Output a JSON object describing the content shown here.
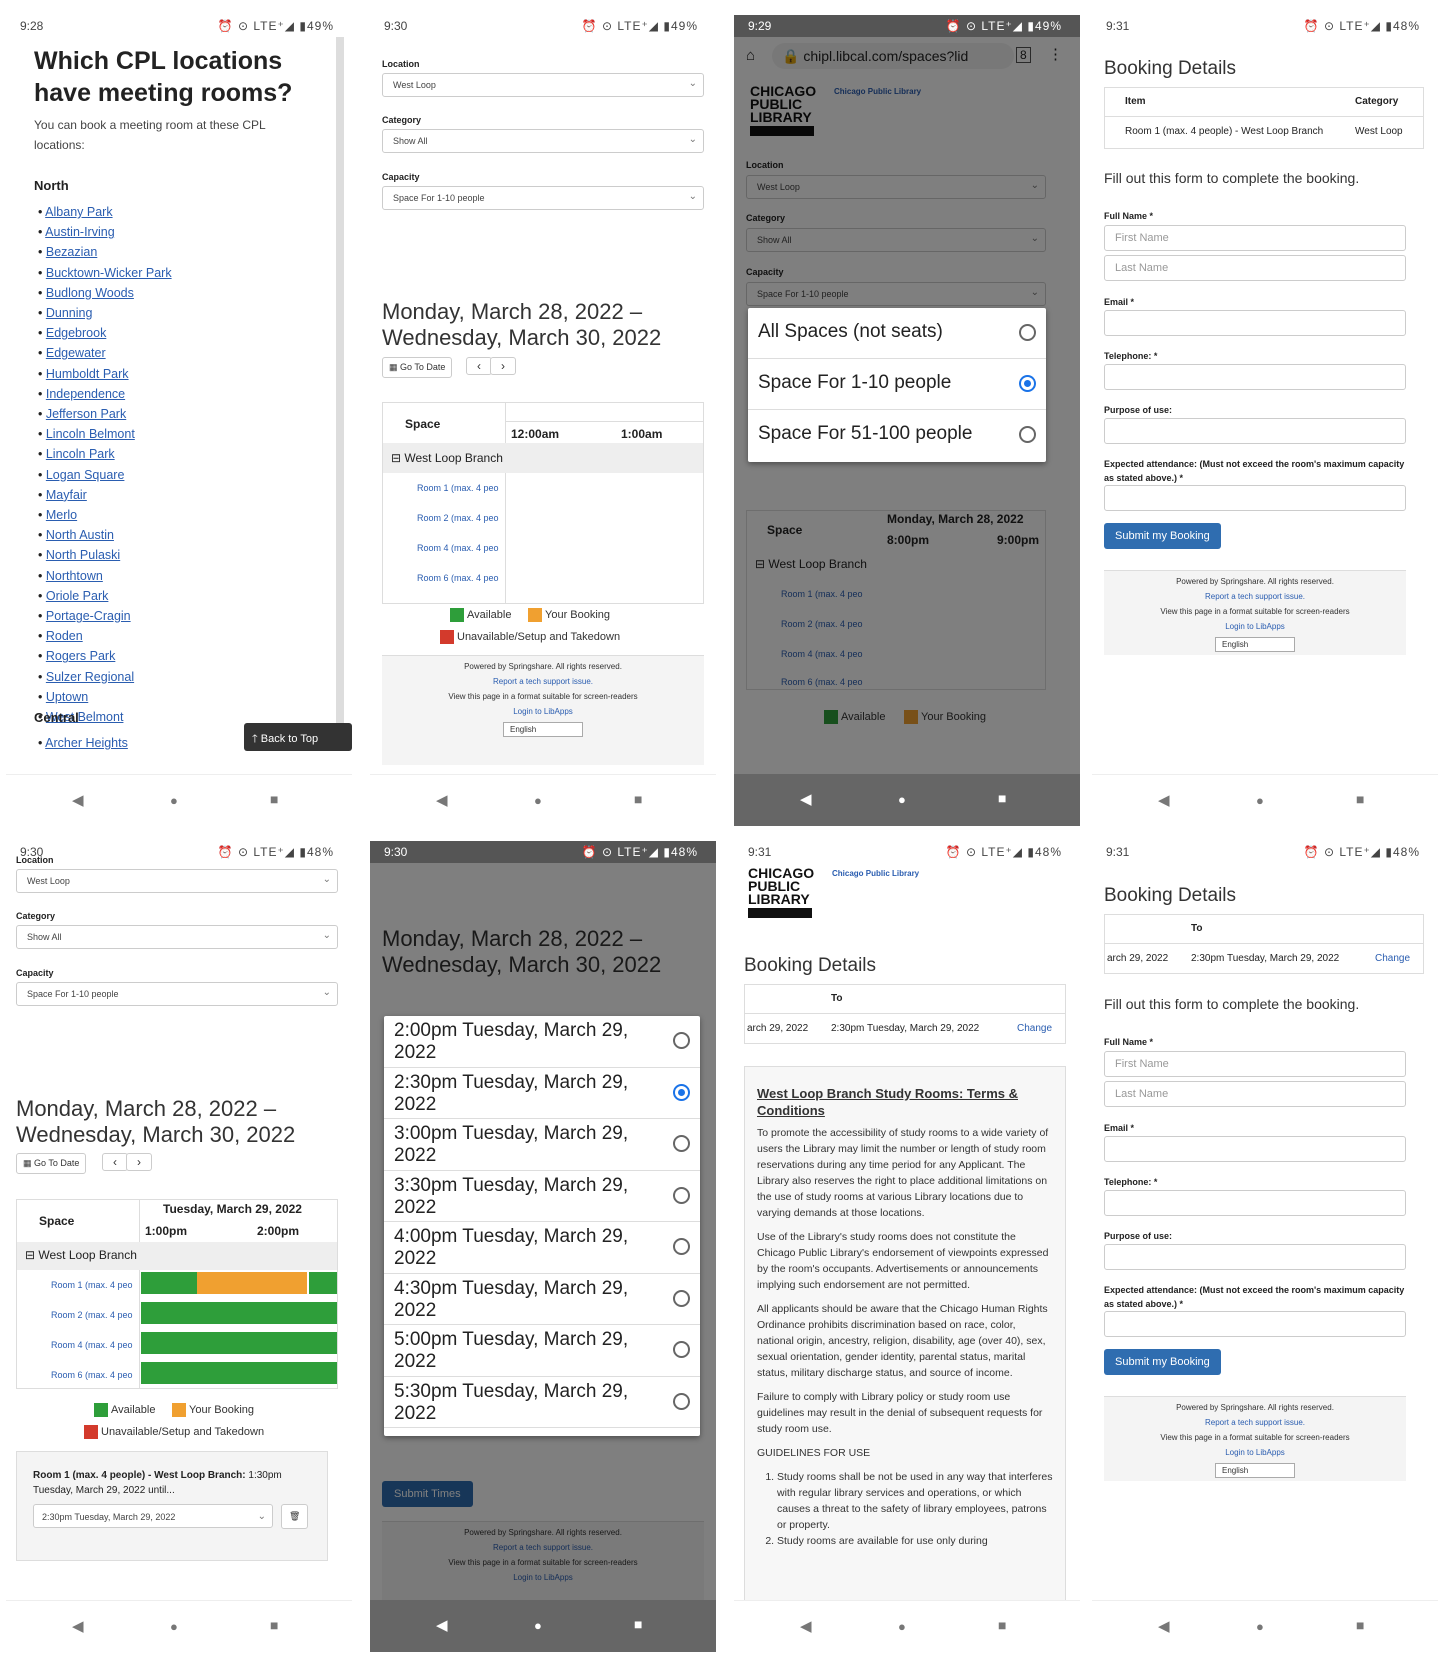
{
  "status_bar": {
    "times": [
      "9:28",
      "9:30",
      "9:29",
      "9:31",
      "9:30",
      "9:30",
      "9:31",
      "9:31"
    ],
    "icons": [
      "⏰ ⊙ LTE⁺◢ ▮49%",
      "⏰ ⊙ LTE⁺◢ ▮49%",
      "⏰ ⊙ LTE⁺◢ ▮49%",
      "⏰ ⊙ LTE⁺◢ ▮48%",
      "⏰ ⊙ LTE⁺◢ ▮48%",
      "⏰ ⊙ LTE⁺◢ ▮48%",
      "⏰ ⊙ LTE⁺◢ ▮48%",
      "⏰ ⊙ LTE⁺◢ ▮48%"
    ]
  },
  "locations_page": {
    "title": "Which CPL locations have meeting rooms?",
    "intro": "You can book a meeting room at these CPL locations:",
    "north_heading": "North",
    "north": [
      "Albany Park",
      "Austin-Irving",
      "Bezazian",
      "Bucktown-Wicker Park",
      "Budlong Woods",
      "Dunning",
      "Edgebrook",
      "Edgewater",
      "Humboldt Park",
      "Independence",
      "Jefferson Park",
      "Lincoln Belmont",
      "Lincoln Park",
      "Logan Square",
      "Mayfair",
      "Merlo",
      "North Austin",
      "North Pulaski",
      "Northtown",
      "Oriole Park",
      "Portage-Cragin",
      "Roden",
      "Rogers Park",
      "Sulzer Regional",
      "Uptown",
      "West Belmont"
    ],
    "central_heading": "Central",
    "central": [
      "Archer Heights"
    ],
    "back_to_top": "Back to Top"
  },
  "filters": {
    "location_label": "Location",
    "location_value": "West Loop",
    "category_label": "Category",
    "category_value": "Show All",
    "capacity_label": "Capacity",
    "capacity_value": "Space For 1-10 people"
  },
  "calendar": {
    "date_range": "Monday, March 28, 2022 – Wednesday, March 30, 2022",
    "go_to_date": "Go To Date",
    "space_header": "Space",
    "branch": "West Loop Branch",
    "rooms": [
      "Room 1 (max. 4 peo",
      "Room 2 (max. 4 peo",
      "Room 4 (max. 4 peo",
      "Room 6 (max. 4 peo"
    ],
    "times_a": [
      "12:00am",
      "1:00am"
    ],
    "day_b": "Monday, March 28, 2022",
    "times_b": [
      "8:00pm",
      "9:00pm"
    ],
    "day_c": "Tuesday, March 29, 2022",
    "times_c": [
      "1:00pm",
      "2:00pm"
    ]
  },
  "legend": {
    "available": "Available",
    "your_booking": "Your Booking",
    "unavailable": "Unavailable/Setup and Takedown",
    "colors": {
      "available": "#2e9e3a",
      "your_booking": "#f0a030",
      "unavailable": "#d33a2c"
    }
  },
  "footer": {
    "powered": "Powered by Springshare. All rights reserved.",
    "report": "Report a tech support issue.",
    "view": "View this page in a format suitable for screen-readers",
    "login": "Login to LibApps",
    "language": "English"
  },
  "browser": {
    "url": "chipl.libcal.com/spaces?lid"
  },
  "logo": {
    "line1": "CHICAGO",
    "line2": "PUBLIC",
    "line3": "LIBRARY",
    "link": "Chicago Public Library"
  },
  "capacity_options": [
    {
      "label": "All Spaces (not seats)",
      "selected": false
    },
    {
      "label": "Space For 1-10 people",
      "selected": true
    },
    {
      "label": "Space For 51-100 people",
      "selected": false
    }
  ],
  "booking_selection": {
    "summary_bold": "Room 1 (max. 4 people) - West Loop Branch:",
    "summary_rest": " 1:30pm Tuesday, March 29, 2022 until...",
    "end_time": "2:30pm Tuesday, March 29, 2022"
  },
  "end_time_options": [
    {
      "label": "2:00pm Tuesday, March 29, 2022",
      "selected": false
    },
    {
      "label": "2:30pm Tuesday, March 29, 2022",
      "selected": true
    },
    {
      "label": "3:00pm Tuesday, March 29, 2022",
      "selected": false
    },
    {
      "label": "3:30pm Tuesday, March 29, 2022",
      "selected": false
    },
    {
      "label": "4:00pm Tuesday, March 29, 2022",
      "selected": false
    },
    {
      "label": "4:30pm Tuesday, March 29, 2022",
      "selected": false
    },
    {
      "label": "5:00pm Tuesday, March 29, 2022",
      "selected": false
    },
    {
      "label": "5:30pm Tuesday, March 29, 2022",
      "selected": false
    }
  ],
  "submit_times": "Submit Times",
  "booking": {
    "title": "Booking Details",
    "col_item": "Item",
    "col_category": "Category",
    "item": "Room 1 (max. 4 people) - West Loop Branch",
    "category": "West Loop",
    "col_to": "To",
    "from_cut": "arch 29, 2022",
    "to": "2:30pm Tuesday, March 29, 2022",
    "change": "Change",
    "instruction": "Fill out this form to complete the booking.",
    "full_name": "Full Name *",
    "first_ph": "First Name",
    "last_ph": "Last Name",
    "email": "Email *",
    "telephone": "Telephone: *",
    "purpose": "Purpose of use:",
    "attendance": "Expected attendance: (Must not exceed the room's maximum capacity as stated above.) *",
    "submit": "Submit my Booking"
  },
  "terms": {
    "title": "West Loop Branch Study Rooms: Terms & Conditions",
    "p1": "To promote the accessibility of study rooms to a wide variety of users the Library may limit the number or length of study room reservations during any time period for any Applicant. The Library also reserves the right to place additional limitations on the use of study rooms at various Library locations due to varying demands at those locations.",
    "p2": "Use of the Library's study rooms does not constitute the Chicago Public Library's endorsement of viewpoints expressed by the room's occupants. Advertisements or announcements implying such endorsement are not permitted.",
    "p3": "All applicants should be aware that the Chicago Human Rights Ordinance prohibits discrimination based on race, color, national origin, ancestry, religion, disability, age (over 40), sex, sexual orientation, gender identity, parental status, marital status, military discharge status, and source of income.",
    "p4": "Failure to comply with Library policy or study room use guidelines may result in the denial of subsequent requests for study room use.",
    "guidelines": "GUIDELINES FOR USE",
    "g1": "Study rooms shall be not be used in any way that interferes with regular library services and operations, or which causes a threat to the safety of library employees, patrons or property.",
    "g2": "Study rooms are available for use only during"
  }
}
